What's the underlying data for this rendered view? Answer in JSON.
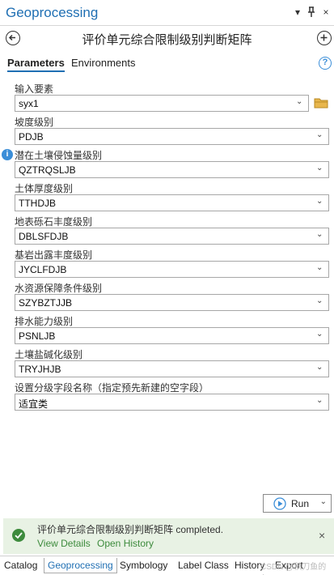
{
  "window": {
    "title": "Geoprocessing",
    "controls": {
      "menu_glyph": "▾",
      "pin_glyph": "₹",
      "close_glyph": "×"
    }
  },
  "tool": {
    "title": "评价单元综合限制级别判断矩阵",
    "back_icon": "back-arrow-icon",
    "add_icon": "add-icon"
  },
  "tabs": [
    {
      "label": "Parameters",
      "active": true
    },
    {
      "label": "Environments",
      "active": false
    }
  ],
  "help_glyph": "?",
  "params": [
    {
      "label": "输入要素",
      "value": "syx1",
      "has_folder": true
    },
    {
      "label": "坡度级别",
      "value": "PDJB"
    },
    {
      "label": "潜在土壤侵蚀量级别",
      "value": "QZTRQSLJB",
      "has_info": true
    },
    {
      "label": "土体厚度级别",
      "value": "TTHDJB"
    },
    {
      "label": "地表砾石丰度级别",
      "value": "DBLSFDJB"
    },
    {
      "label": "基岩出露丰度级别",
      "value": "JYCLFDJB"
    },
    {
      "label": "水资源保障条件级别",
      "value": "SZYBZTJJB"
    },
    {
      "label": "排水能力级别",
      "value": "PSNLJB"
    },
    {
      "label": "土壤盐碱化级别",
      "value": "TRYJHJB"
    },
    {
      "label": "设置分级字段名称（指定预先新建的空字段）",
      "value": "适宜类"
    }
  ],
  "run_button": {
    "label": "Run"
  },
  "status": {
    "message": "评价单元综合限制级别判断矩阵 completed.",
    "links": [
      "View Details",
      "Open History"
    ],
    "close_glyph": "×",
    "color": "#3d8b3d"
  },
  "bottom_tabs": [
    {
      "label": "Catalog",
      "active": false
    },
    {
      "label": "Geoprocessing",
      "active": true
    },
    {
      "label": "Symbology",
      "active": false
    },
    {
      "label": "Label Class",
      "active": false
    },
    {
      "label": "History",
      "active": false
    },
    {
      "label": "Export",
      "active": false
    }
  ],
  "watermark": "CSDN @秋刀鱼的鱼子",
  "colors": {
    "accent": "#1f6fb3",
    "info": "#3b8ed8",
    "success": "#3d8b3d"
  }
}
